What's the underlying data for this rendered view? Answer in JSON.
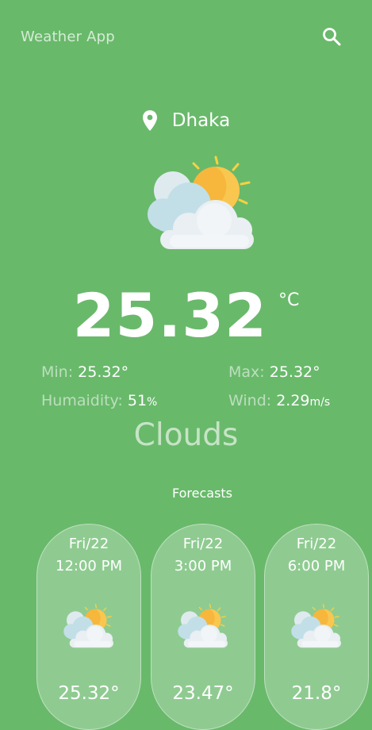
{
  "app": {
    "title": "Weather App",
    "search_icon": "search-icon",
    "background_color": "#69b96b"
  },
  "location": {
    "icon": "location-pin-icon",
    "city": "Dhaka"
  },
  "current": {
    "icon": "partly-cloudy-icon",
    "temperature": "25.32",
    "unit": "°C",
    "min_label": "Min:",
    "min_value": "25.32°",
    "max_label": "Max:",
    "max_value": "25.32°",
    "humidity_label": "Humaidity:",
    "humidity_value": "51",
    "humidity_unit": "%",
    "wind_label": "Wind:",
    "wind_value": "2.29",
    "wind_unit": "m/s",
    "condition": "Clouds"
  },
  "forecasts": {
    "label": "Forecasts",
    "items": [
      {
        "date": "Fri/22",
        "time": "12:00 PM",
        "icon": "partly-cloudy-icon",
        "temp": "25.32°"
      },
      {
        "date": "Fri/22",
        "time": "3:00 PM",
        "icon": "partly-cloudy-icon",
        "temp": "23.47°"
      },
      {
        "date": "Fri/22",
        "time": "6:00 PM",
        "icon": "partly-cloudy-icon",
        "temp": "21.8°"
      }
    ]
  }
}
